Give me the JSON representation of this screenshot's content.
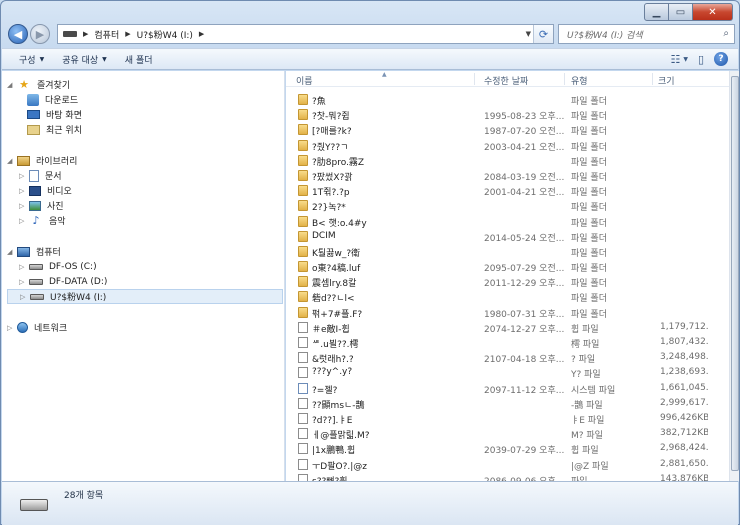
{
  "window": {
    "caption_buttons": [
      "minimize",
      "maximize",
      "close"
    ]
  },
  "address": {
    "crumbs": [
      "컴퓨터",
      "U?$粉W4 (I:)"
    ],
    "search_placeholder": "U?$粉W4 (I:) 검색"
  },
  "toolbar": {
    "organize": "구성",
    "share": "공유 대상",
    "new_folder": "새 폴더"
  },
  "nav": {
    "favorites": "즐겨찾기",
    "downloads": "다운로드",
    "desktop": "바탕 화면",
    "recent": "최근 위치",
    "libraries": "라이브러리",
    "documents": "문서",
    "videos": "비디오",
    "pictures": "사진",
    "music": "음악",
    "computer": "컴퓨터",
    "drive_c": "DF-OS (C:)",
    "drive_d": "DF-DATA (D:)",
    "drive_i": "U?$粉W4 (I:)",
    "network": "네트워크"
  },
  "columns": {
    "name": "이름",
    "date": "수정한 날짜",
    "type": "유형",
    "size": "크기"
  },
  "files": [
    {
      "name": "?魚",
      "date": "",
      "type": "파일 폴더",
      "size": "",
      "kind": "folder"
    },
    {
      "name": "?찻-뭐?쥡",
      "date": "1995-08-23 오후...",
      "type": "파일 폴더",
      "size": "",
      "kind": "folder"
    },
    {
      "name": "[?매를?k?",
      "date": "1987-07-20 오전...",
      "type": "파일 폴더",
      "size": "",
      "kind": "folder"
    },
    {
      "name": "?줬Y??ㄱ",
      "date": "2003-04-21 오전...",
      "type": "파일 폴더",
      "size": "",
      "kind": "folder"
    },
    {
      "name": "?肋8pro.霧Z",
      "date": "",
      "type": "파일 폴더",
      "size": "",
      "kind": "folder"
    },
    {
      "name": "?팠썼X?괅",
      "date": "2084-03-19 오전...",
      "type": "파일 폴더",
      "size": "",
      "kind": "folder"
    },
    {
      "name": "1T쥒?.?p",
      "date": "2001-04-21 오전...",
      "type": "파일 폴더",
      "size": "",
      "kind": "folder"
    },
    {
      "name": "2?}녹?*",
      "date": "",
      "type": "파일 폴더",
      "size": "",
      "kind": "folder"
    },
    {
      "name": "B< 햇:o.4#y",
      "date": "",
      "type": "파일 폴더",
      "size": "",
      "kind": "folder"
    },
    {
      "name": "DCIM",
      "date": "2014-05-24 오전...",
      "type": "파일 폴더",
      "size": "",
      "kind": "folder"
    },
    {
      "name": "K퉐끓w_?衛",
      "date": "",
      "type": "파일 폴더",
      "size": "",
      "kind": "folder"
    },
    {
      "name": "o東?4稿.luf",
      "date": "2095-07-29 오전...",
      "type": "파일 폴더",
      "size": "",
      "kind": "folder"
    },
    {
      "name": "震셈lry.8칼",
      "date": "2011-12-29 오후...",
      "type": "파일 폴더",
      "size": "",
      "kind": "folder"
    },
    {
      "name": "砦d??ㄴl<",
      "date": "",
      "type": "파일 폴더",
      "size": "",
      "kind": "folder"
    },
    {
      "name": "퍾+7#플.F?",
      "date": "1980-07-31 오후...",
      "type": "파일 폴더",
      "size": "",
      "kind": "folder"
    },
    {
      "name": "＃e敵Ⅰ-휩",
      "date": "2074-12-27 오후...",
      "type": "휩 파일",
      "size": "1,179,712...",
      "kind": "file"
    },
    {
      "name": "ᄹ.u뵐??.樗",
      "date": "",
      "type": "樗 파일",
      "size": "1,807,432...",
      "kind": "file"
    },
    {
      "name": "&럿래h?.?",
      "date": "2107-04-18 오후...",
      "type": "? 파일",
      "size": "3,248,498...",
      "kind": "file"
    },
    {
      "name": "???y^.y?",
      "date": "",
      "type": "Y? 파일",
      "size": "1,238,693...",
      "kind": "file"
    },
    {
      "name": "?=젤?",
      "date": "2097-11-12 오후...",
      "type": "시스템 파일",
      "size": "1,661,045...",
      "kind": "sys"
    },
    {
      "name": "??顯msㄴ-鵲",
      "date": "",
      "type": "-鵲 파일",
      "size": "2,999,617...",
      "kind": "file"
    },
    {
      "name": "?d??].ㅑE",
      "date": "",
      "type": "ㅑE 파일",
      "size": "996,426KB",
      "kind": "file"
    },
    {
      "name": "ㅔ@플맑릷.M?",
      "date": "",
      "type": "M? 파일",
      "size": "382,712KB",
      "kind": "file"
    },
    {
      "name": "|1x鵬鴨.휩",
      "date": "2039-07-29 오후...",
      "type": "휩 파일",
      "size": "2,968,424...",
      "kind": "file"
    },
    {
      "name": "ㅜD팔O?.|@z",
      "date": "",
      "type": "|@Z 파일",
      "size": "2,881,650...",
      "kind": "file"
    },
    {
      "name": "s??뼈?휩",
      "date": "2086-09-06 오후...",
      "type": "파일",
      "size": "143,876KB",
      "kind": "file"
    }
  ],
  "details": {
    "count": "28개 항목"
  }
}
